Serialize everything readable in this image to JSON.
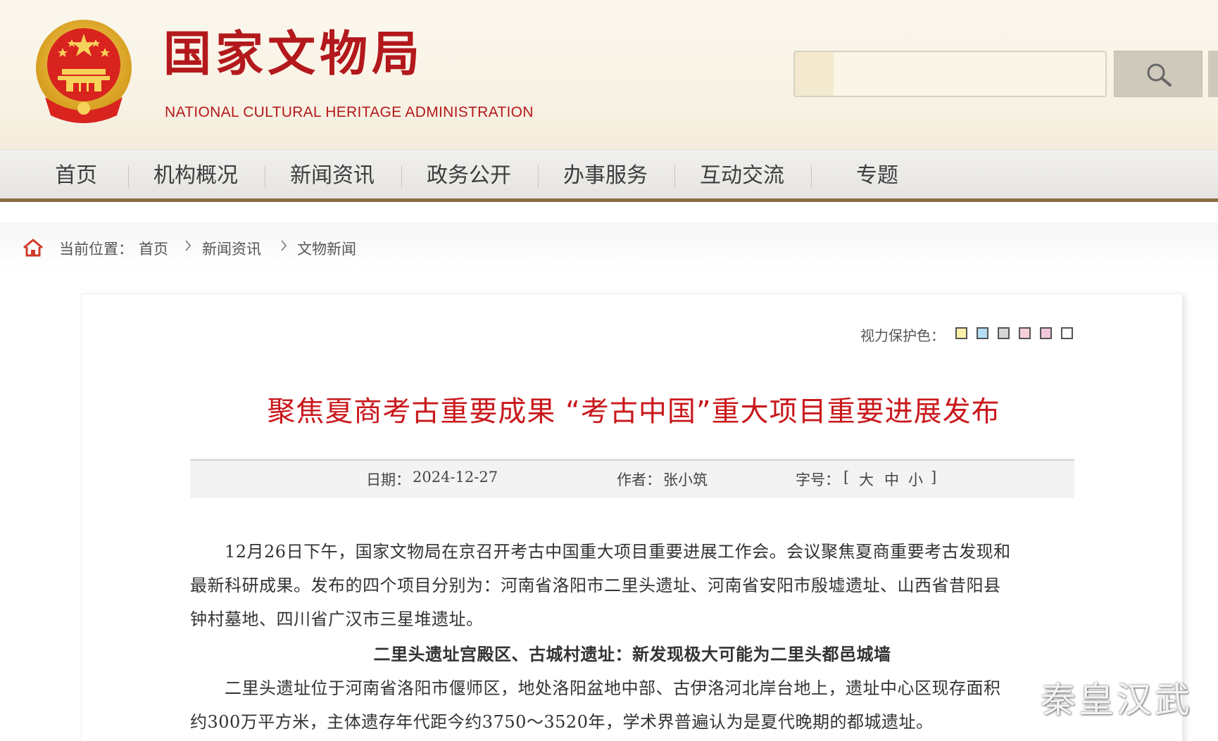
{
  "header": {
    "title": "国家文物局",
    "subtitle": "NATIONAL  CULTURAL HERITAGE ADMINISTRATION",
    "search_placeholder": "",
    "brand_color": "#b3191c"
  },
  "nav": {
    "items": [
      {
        "label": "首页"
      },
      {
        "label": "机构概况"
      },
      {
        "label": "新闻资讯"
      },
      {
        "label": "政务公开"
      },
      {
        "label": "办事服务"
      },
      {
        "label": "互动交流"
      },
      {
        "label": "专题"
      }
    ]
  },
  "breadcrumb": {
    "prefix": "当前位置：",
    "items": [
      "首页",
      "新闻资讯",
      "文物新闻"
    ]
  },
  "eye_care": {
    "label": "视力保护色：",
    "colors": [
      "#faf0a8",
      "#b2dff5",
      "#d6d6d6",
      "#f6cfd9",
      "#f4c6dc",
      "#ffffff"
    ]
  },
  "article": {
    "title": "聚焦夏商考古重要成果  “考古中国”重大项目重要进展发布",
    "meta": {
      "date_label": "日期：",
      "date": "2024-12-27",
      "author_label": "作者：",
      "author": "张小筑",
      "fontsize_label": "字号：",
      "bracket_open": "[",
      "large": "大",
      "medium": "中",
      "small": "小",
      "bracket_close": "]"
    },
    "paragraphs": [
      {
        "lines": [
          "　　12月26日下午，国家文物局在京召开考古中国重大项目重要进展工作会。会议聚焦夏商重要考古发现和",
          "最新科研成果。发布的四个项目分别为：河南省洛阳市二里头遗址、河南省安阳市殷墟遗址、山西省昔阳县",
          "钟村墓地、四川省广汉市三星堆遗址。"
        ]
      },
      {
        "lines": [
          "　　二里头遗址位于河南省洛阳市偃师区，地处洛阳盆地中部、古伊洛河北岸台地上，遗址中心区现存面积",
          "约300万平方米，主体遗存年代距今约3750～3520年，学术界普遍认为是夏代晚期的都城遗址。"
        ]
      }
    ],
    "subheading": "二里头遗址宫殿区、古城村遗址：新发现极大可能为二里头都邑城墙"
  },
  "watermark": "秦皇汉武"
}
